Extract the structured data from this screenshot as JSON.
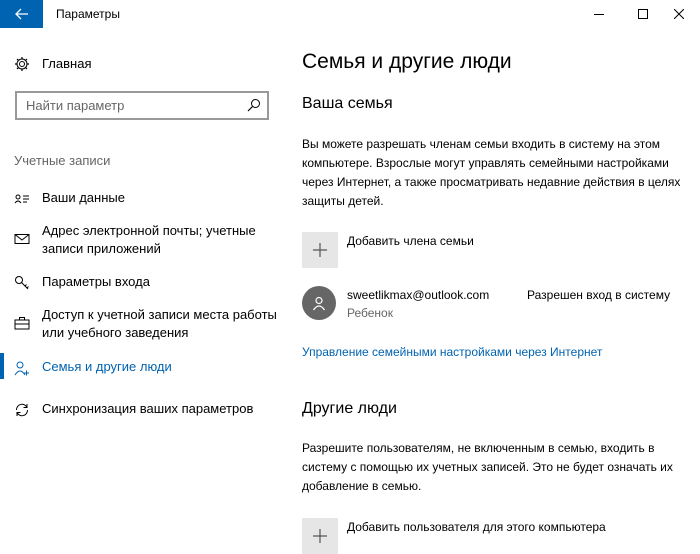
{
  "window": {
    "title": "Параметры",
    "back_icon": "back-arrow-icon",
    "accent_color": "#0063b1"
  },
  "sidebar": {
    "home_label": "Главная",
    "search_placeholder": "Найти параметр",
    "section_header": "Учетные записи",
    "items": [
      {
        "label": "Ваши данные",
        "icon": "person-card-icon",
        "active": false
      },
      {
        "label": "Адрес электронной почты; учетные записи приложений",
        "icon": "mail-icon",
        "active": false
      },
      {
        "label": "Параметры входа",
        "icon": "key-icon",
        "active": false
      },
      {
        "label": "Доступ к учетной записи места работы или учебного заведения",
        "icon": "briefcase-icon",
        "active": false
      },
      {
        "label": "Семья и другие люди",
        "icon": "family-icon",
        "active": true
      },
      {
        "label": "Синхронизация ваших параметров",
        "icon": "sync-icon",
        "active": false
      }
    ]
  },
  "main": {
    "title": "Семья и другие люди",
    "family": {
      "heading": "Ваша семья",
      "description": "Вы можете разрешать членам семьи входить в систему на этом компьютере. Взрослые могут управлять семейными настройками через Интернет, а также просматривать недавние действия в целях защиты детей.",
      "add_label": "Добавить члена семьи",
      "member": {
        "email": "sweetlikmax@outlook.com",
        "role": "Ребенок",
        "status": "Разрешен вход в систему"
      },
      "manage_link": "Управление семейными настройками через Интернет"
    },
    "others": {
      "heading": "Другие люди",
      "description": "Разрешите пользователям, не включенным в семью, входить в систему с помощью их учетных записей. Это не будет означать их добавление в семью.",
      "add_label": "Добавить пользователя для этого компьютера"
    }
  }
}
